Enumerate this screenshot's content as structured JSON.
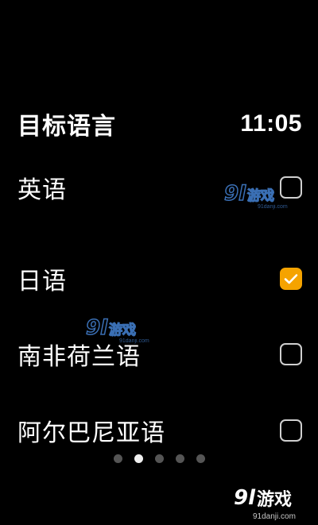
{
  "header": {
    "title": "目标语言",
    "time": "11:05"
  },
  "languages": [
    {
      "label": "英语",
      "checked": false
    },
    {
      "label": "日语",
      "checked": true
    },
    {
      "label": "南非荷兰语",
      "checked": false
    },
    {
      "label": "阿尔巴尼亚语",
      "checked": false
    }
  ],
  "pager": {
    "count": 5,
    "active_index": 1
  },
  "watermark": {
    "brand_number": "9l",
    "brand_text": "游戏",
    "domain": "91danji.com"
  },
  "colors": {
    "accent": "#f5a300",
    "background": "#000000",
    "checkbox_border": "#cfcfcf",
    "dot_inactive": "#555555",
    "dot_active": "#f0f0f0",
    "watermark_blue": "#3a6fb4"
  }
}
